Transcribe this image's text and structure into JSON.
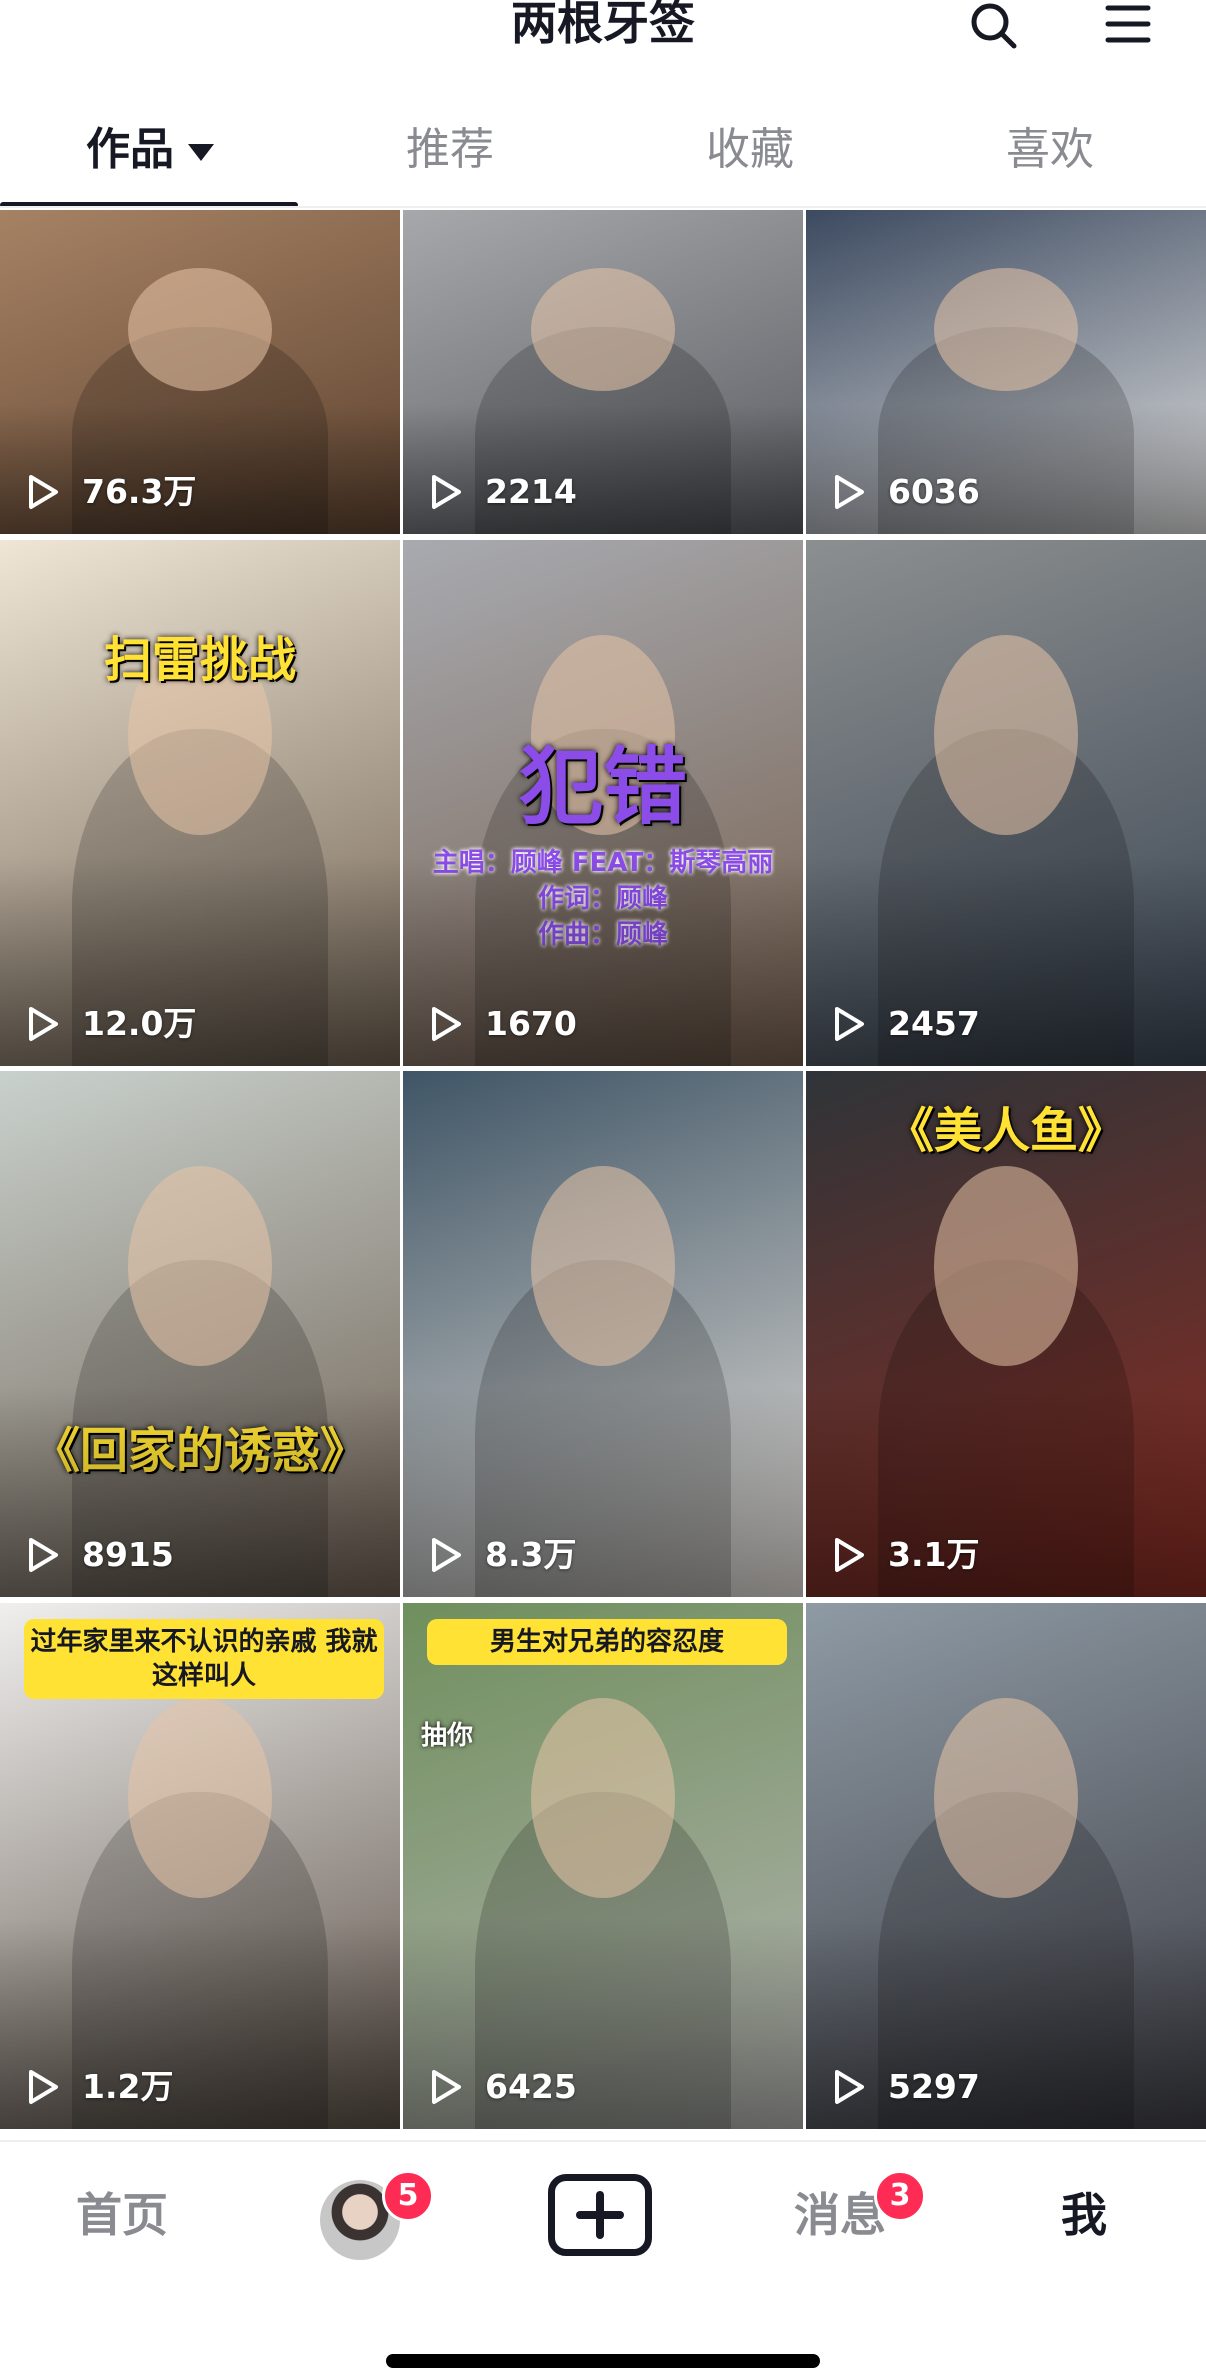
{
  "header": {
    "title": "两根牙签"
  },
  "tabs": [
    {
      "label": "作品",
      "active": true
    },
    {
      "label": "推荐",
      "active": false
    },
    {
      "label": "收藏",
      "active": false
    },
    {
      "label": "喜欢",
      "active": false
    }
  ],
  "videos": [
    {
      "plays": "76.3万",
      "bg": [
        "#a68264",
        "#5e4330"
      ],
      "caption": ""
    },
    {
      "plays": "2214",
      "bg": [
        "#a6a8ab",
        "#585b60"
      ],
      "caption": ""
    },
    {
      "plays": "6036",
      "bg": [
        "#3c4a60",
        "#dedede"
      ],
      "caption": ""
    },
    {
      "plays": "12.0万",
      "bg": [
        "#efe6d6",
        "#6f6152"
      ],
      "caption": "扫雷挑战",
      "caption_color": "#ffe234"
    },
    {
      "plays": "1670",
      "bg": [
        "#a8aab0",
        "#755f4d"
      ],
      "caption": "犯错",
      "caption_color": "#8b4ce8",
      "sub": [
        "主唱：顾峰 FEAT：斯琴高丽",
        "作词：顾峰",
        "作曲：顾峰"
      ]
    },
    {
      "plays": "2457",
      "bg": [
        "#8c8f90",
        "#3b4654"
      ],
      "caption": ""
    },
    {
      "plays": "8915",
      "bg": [
        "#c9d1cc",
        "#6e6053"
      ],
      "caption": "《回家的诱惑》",
      "caption_color": "#ffe234"
    },
    {
      "plays": "8.3万",
      "bg": [
        "#3f5566",
        "#e3ded8"
      ],
      "caption": ""
    },
    {
      "plays": "3.1万",
      "bg": [
        "#2f3438",
        "#8a2c22"
      ],
      "caption": "《美人鱼》",
      "caption_color": "#ffe234"
    },
    {
      "plays": "1.2万",
      "bg": [
        "#f0efee",
        "#5c5147"
      ],
      "caption": "过年家里来不认识的亲戚 我就这样叫人",
      "caption_box": true
    },
    {
      "plays": "6425",
      "bg": [
        "#6f8f5d",
        "#b4b4b1"
      ],
      "caption": "男生对兄弟的容忍度",
      "caption_box": true,
      "extra": "抽你"
    },
    {
      "plays": "5297",
      "bg": [
        "#8e9aa4",
        "#3f3f46"
      ],
      "caption": ""
    }
  ],
  "bottom_nav": {
    "home": "首页",
    "friends_badge": "5",
    "messages": "消息",
    "messages_badge": "3",
    "me": "我"
  },
  "icons": {
    "search": "search-icon",
    "menu": "menu-icon",
    "create": "plus-icon",
    "play": "play-icon"
  }
}
